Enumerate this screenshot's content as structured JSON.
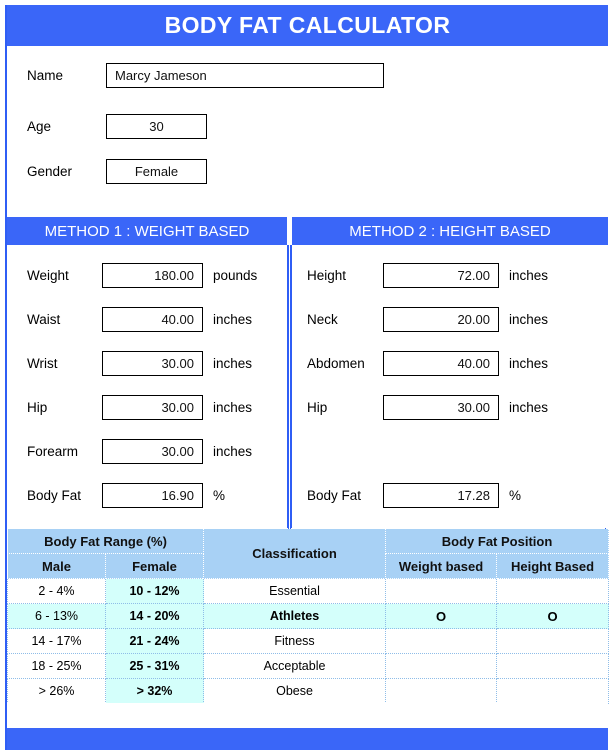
{
  "header": {
    "title": "BODY FAT CALCULATOR"
  },
  "colors": {
    "banner_blue": "#3a66f8",
    "frame_blue": "#2f5ef5",
    "table_header_blue": "#a8d1f5",
    "highlight_cyan": "#d4fffb",
    "input_border": "#000000",
    "text": "#000000"
  },
  "person": {
    "name": {
      "label": "Name",
      "value": "Marcy Jameson"
    },
    "age": {
      "label": "Age",
      "value": "30"
    },
    "gender": {
      "label": "Gender",
      "value": "Female"
    }
  },
  "method1": {
    "heading": "METHOD 1 : WEIGHT BASED",
    "fields": [
      {
        "label": "Weight",
        "value": "180.00",
        "unit": "pounds"
      },
      {
        "label": "Waist",
        "value": "40.00",
        "unit": "inches"
      },
      {
        "label": "Wrist",
        "value": "30.00",
        "unit": "inches"
      },
      {
        "label": "Hip",
        "value": "30.00",
        "unit": "inches"
      },
      {
        "label": "Forearm",
        "value": "30.00",
        "unit": "inches"
      },
      {
        "label": "Body Fat",
        "value": "16.90",
        "unit": "%"
      }
    ]
  },
  "method2": {
    "heading": "METHOD 2 : HEIGHT BASED",
    "fields": [
      {
        "label": "Height",
        "value": "72.00",
        "unit": "inches"
      },
      {
        "label": "Neck",
        "value": "20.00",
        "unit": "inches"
      },
      {
        "label": "Abdomen",
        "value": "40.00",
        "unit": "inches"
      },
      {
        "label": "Hip",
        "value": "30.00",
        "unit": "inches"
      },
      {
        "label": "Body Fat",
        "value": "17.28",
        "unit": "%"
      }
    ]
  },
  "table": {
    "group_headers": {
      "range": "Body Fat Range (%)",
      "classification": "Classification",
      "position": "Body Fat Position"
    },
    "sub_headers": {
      "male": "Male",
      "female": "Female",
      "weight_based": "Weight based",
      "height_based": "Height Based"
    },
    "rows": [
      {
        "male": "2 - 4%",
        "female": "10 - 12%",
        "classification": "Essential",
        "weight_based": "",
        "height_based": "",
        "highlighted": false
      },
      {
        "male": "6 - 13%",
        "female": "14 - 20%",
        "classification": "Athletes",
        "weight_based": "O",
        "height_based": "O",
        "highlighted": true
      },
      {
        "male": "14 - 17%",
        "female": "21 - 24%",
        "classification": "Fitness",
        "weight_based": "",
        "height_based": "",
        "highlighted": false
      },
      {
        "male": "18 - 25%",
        "female": "25 - 31%",
        "classification": "Acceptable",
        "weight_based": "",
        "height_based": "",
        "highlighted": false
      },
      {
        "male": "> 26%",
        "female": "> 32%",
        "classification": "Obese",
        "weight_based": "",
        "height_based": "",
        "highlighted": false
      }
    ]
  }
}
